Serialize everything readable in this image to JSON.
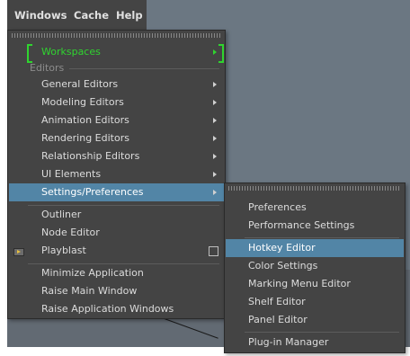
{
  "menubar": {
    "items": [
      "Windows",
      "Cache",
      "Help"
    ]
  },
  "main_menu": {
    "workspaces_label": "Workspaces",
    "editors_section": "Editors",
    "items": [
      "General Editors",
      "Modeling Editors",
      "Animation Editors",
      "Rendering Editors",
      "Relationship Editors",
      "UI Elements",
      "Settings/Preferences",
      "Outliner",
      "Node Editor",
      "Playblast",
      "Minimize Application",
      "Raise Main Window",
      "Raise Application Windows"
    ]
  },
  "submenu": {
    "items": [
      "Preferences",
      "Performance Settings",
      "Hotkey Editor",
      "Color Settings",
      "Marking Menu Editor",
      "Shelf Editor",
      "Panel Editor",
      "Plug-in Manager"
    ]
  },
  "colors": {
    "menu_bg": "#444444",
    "highlight": "#5285a6",
    "workspaces_green": "#2fd42f",
    "viewport_bg": "#6b7782"
  },
  "icons": [
    "chevron-right-icon",
    "playblast-icon",
    "checkbox-icon",
    "tearoff-handle"
  ]
}
